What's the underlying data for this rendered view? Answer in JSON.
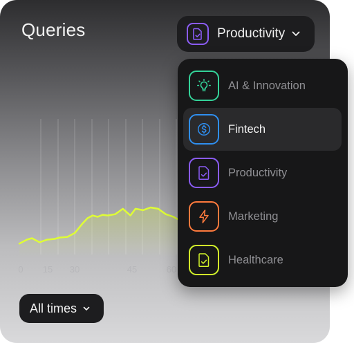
{
  "title": "Queries",
  "category_button": {
    "label": "Productivity",
    "icon": "document-check-icon",
    "accent": "#8b5cf6"
  },
  "time_filter": {
    "label": "All times"
  },
  "dropdown": {
    "items": [
      {
        "label": "AI & Innovation",
        "icon": "lightbulb-icon",
        "color": "#34d399",
        "active": false
      },
      {
        "label": "Fintech",
        "icon": "dollar-coin-icon",
        "color": "#2f8ff0",
        "active": true
      },
      {
        "label": "Productivity",
        "icon": "document-check-icon",
        "color": "#8b5cf6",
        "active": false
      },
      {
        "label": "Marketing",
        "icon": "lightning-icon",
        "color": "#ff7a3d",
        "active": false
      },
      {
        "label": "Healthcare",
        "icon": "document-check-icon",
        "color": "#d4f52a",
        "active": false
      }
    ]
  },
  "chart_data": {
    "type": "line",
    "line_color": "#dffd35",
    "x_ticks": [
      "0",
      "15",
      "30",
      "45",
      "60"
    ],
    "x": [
      0,
      3,
      5,
      8,
      11,
      14,
      16,
      19,
      22,
      25,
      27,
      29,
      31,
      33,
      35,
      38,
      41,
      44,
      46,
      49,
      52,
      55,
      58,
      61,
      63
    ],
    "values": [
      0.08,
      0.14,
      0.16,
      0.1,
      0.14,
      0.15,
      0.17,
      0.18,
      0.24,
      0.38,
      0.46,
      0.5,
      0.48,
      0.51,
      0.5,
      0.52,
      0.6,
      0.5,
      0.6,
      0.58,
      0.62,
      0.6,
      0.52,
      0.48,
      0.44
    ],
    "grid": true
  }
}
